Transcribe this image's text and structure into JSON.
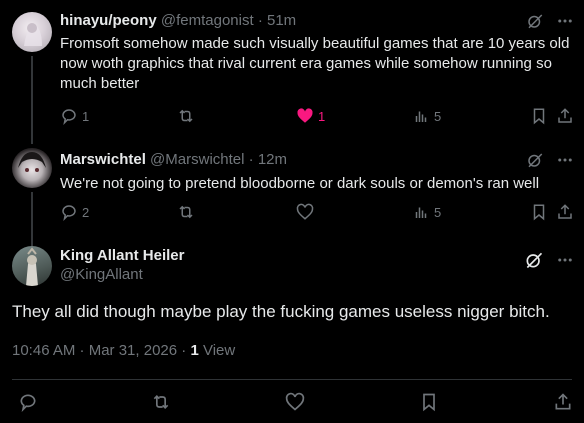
{
  "posts": [
    {
      "name": "hinayu/peony",
      "handle": "@femtagonist",
      "time": "51m",
      "text": "Fromsoft somehow made such visually beautiful games that are 10 years old now woth graphics that rival current era games while somehow running so much better",
      "replies": "1",
      "likes": "1",
      "views": "5"
    },
    {
      "name": "Marswichtel",
      "handle": "@Marswichtel",
      "time": "12m",
      "text": "We're not going to pretend bloodborne or dark souls or demon's ran well",
      "replies": "2",
      "views": "5"
    }
  ],
  "main": {
    "name": "King Allant Heiler",
    "handle": "@KingAllant",
    "text": "They all did though maybe play the fucking games useless nigger bitch.",
    "timestamp": "10:46 AM · Mar 31, 2026",
    "views_count": "1",
    "views_label": "View"
  },
  "separators": {
    "dot": "·"
  },
  "colors": {
    "accent_like": "#f91880",
    "muted": "#71767b",
    "text": "#e7e9ea",
    "background": "#000000"
  },
  "icons": [
    "grok-icon",
    "more-icon",
    "reply-icon",
    "repost-icon",
    "like-icon",
    "views-icon",
    "bookmark-icon",
    "share-icon"
  ]
}
